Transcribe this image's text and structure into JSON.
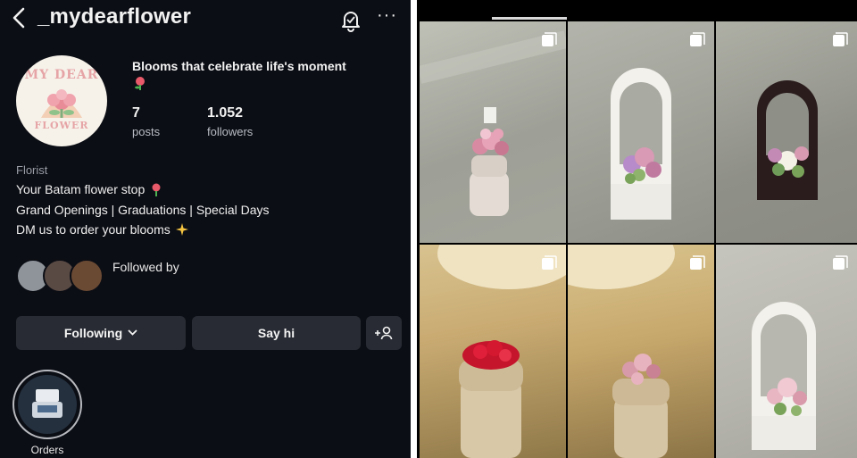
{
  "profile": {
    "username": "_mydearflower",
    "avatar_logo_top": "MY DEAR",
    "avatar_logo_bottom": "FLOWER",
    "headline": "Blooms that celebrate life's moment",
    "stats": {
      "posts_count": "7",
      "posts_label": "posts",
      "followers_count": "1.052",
      "followers_label": "followers"
    },
    "category": "Florist",
    "bio_lines": [
      "Your Batam flower stop",
      "Grand Openings | Graduations | Special Days",
      "DM us to order your blooms"
    ],
    "followed_by": "Followed by",
    "buttons": {
      "following": "Following",
      "say_hi": "Say hi"
    },
    "highlights": [
      {
        "label": "Orders"
      }
    ]
  },
  "icons": {
    "back": "chevron-left-icon",
    "notifications": "bell-icon",
    "more": "more-options-icon",
    "add_user": "add-user-icon",
    "multi_post": "multiple-photos-icon"
  },
  "grid": {
    "posts": [
      {
        "desc": "pink bouquet in white bag"
      },
      {
        "desc": "arch flower box pink"
      },
      {
        "desc": "black arch flower box"
      },
      {
        "desc": "red roses bouquet"
      },
      {
        "desc": "pink roses bouquet"
      },
      {
        "desc": "white arch flower box"
      }
    ]
  },
  "colors": {
    "background": "#0c0e15",
    "button": "#282b33",
    "text": "#f2f2f2",
    "muted_text": "#9a9da6",
    "logo_pink": "#e6a4a6"
  }
}
